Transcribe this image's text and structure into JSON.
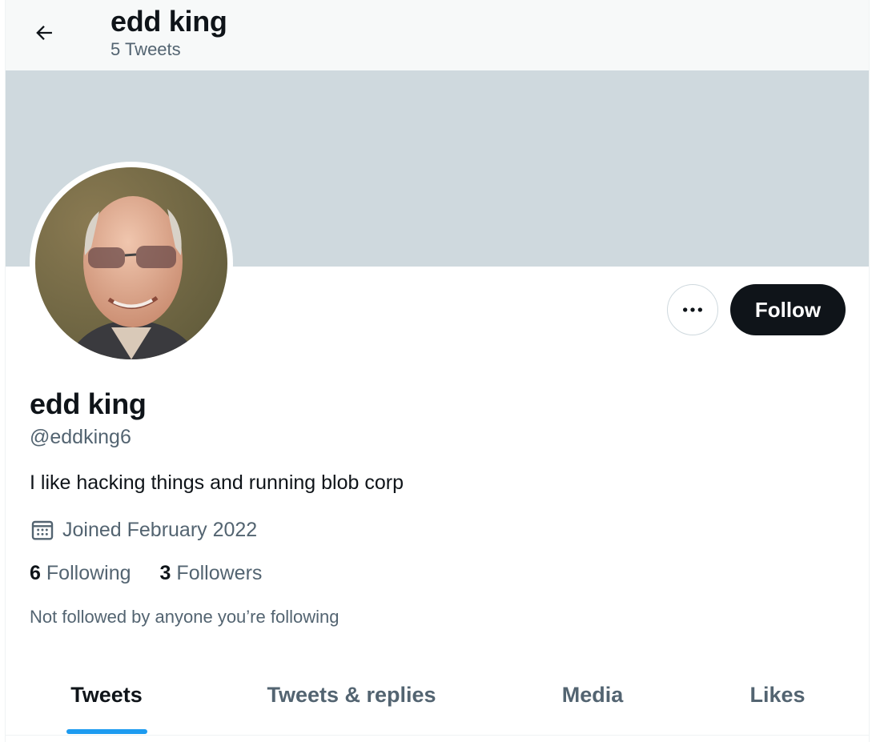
{
  "header": {
    "name": "edd king",
    "tweet_count": "5 Tweets",
    "back_icon": "arrow-left-icon"
  },
  "profile": {
    "display_name": "edd king",
    "handle": "@eddking6",
    "bio": "I like hacking things and running blob corp",
    "joined": "Joined February 2022",
    "joined_icon": "calendar-icon",
    "following_count": "6",
    "following_label": "Following",
    "followers_count": "3",
    "followers_label": "Followers",
    "not_followed_text": "Not followed by anyone you’re following"
  },
  "actions": {
    "more_icon": "more-horizontal-icon",
    "follow_label": "Follow"
  },
  "tabs": [
    {
      "label": "Tweets",
      "active": true
    },
    {
      "label": "Tweets & replies",
      "active": false
    },
    {
      "label": "Media",
      "active": false
    },
    {
      "label": "Likes",
      "active": false
    }
  ],
  "colors": {
    "accent": "#1d9bf0",
    "banner": "#cfd9de",
    "text_primary": "#0f1419",
    "text_secondary": "#536471",
    "follow_button_bg": "#0f1419"
  }
}
